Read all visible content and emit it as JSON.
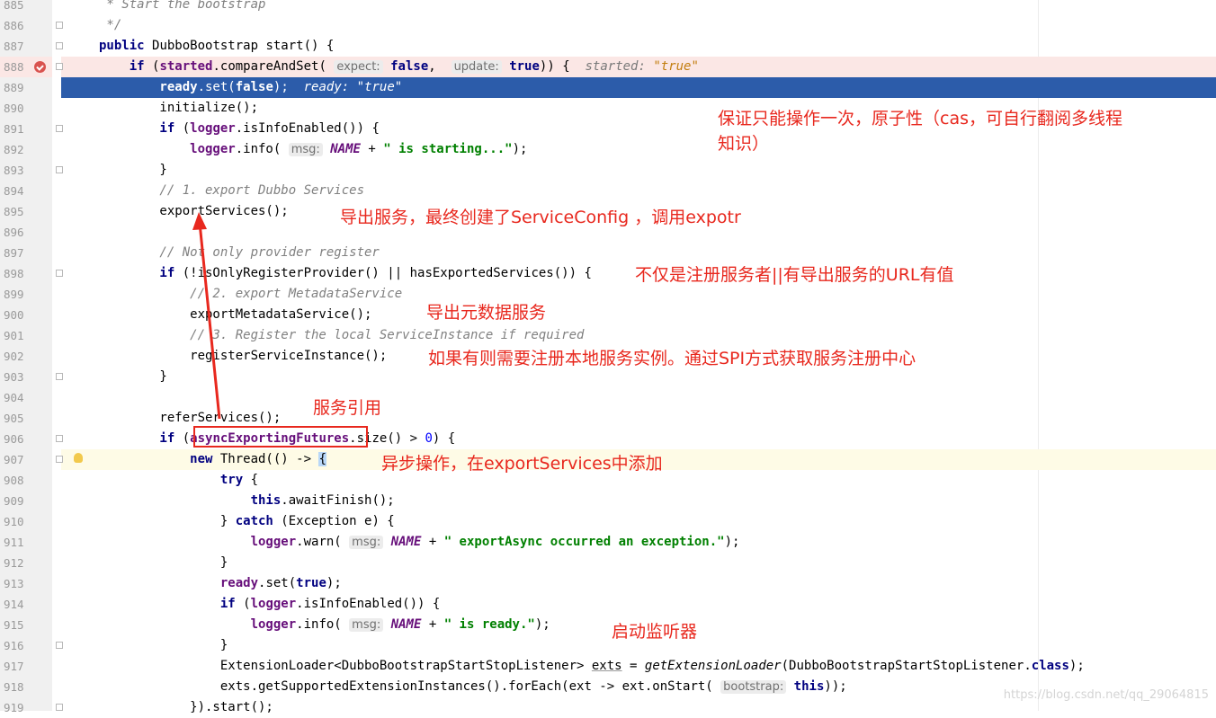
{
  "editor": {
    "lines": [
      {
        "n": "885",
        "parts": [
          {
            "t": " * Start the bootstrap",
            "c": "cmt"
          }
        ]
      },
      {
        "n": "886",
        "parts": [
          {
            "t": " */",
            "c": "cmt"
          }
        ]
      },
      {
        "n": "887",
        "parts": [
          {
            "t": "public ",
            "c": "kw"
          },
          {
            "t": "DubboBootstrap start() {"
          }
        ]
      },
      {
        "n": "888",
        "parts": [
          {
            "t": "    if ",
            "c": "kw"
          },
          {
            "t": "("
          },
          {
            "t": "started",
            "c": "fld"
          },
          {
            "t": ".compareAndSet( "
          },
          {
            "t": "expect:",
            "c": "hint"
          },
          {
            "t": " "
          },
          {
            "t": "false",
            "c": "kw"
          },
          {
            "t": ",  "
          },
          {
            "t": "update:",
            "c": "hint"
          },
          {
            "t": " "
          },
          {
            "t": "true",
            "c": "kw"
          },
          {
            "t": ")) {  "
          },
          {
            "t": "started: ",
            "c": "inl"
          },
          {
            "t": "\"true\"",
            "c": "inls"
          }
        ]
      },
      {
        "n": "889",
        "parts": [
          {
            "t": "        ready",
            "c": "fld"
          },
          {
            "t": ".set("
          },
          {
            "t": "false",
            "c": "kw"
          },
          {
            "t": ");  "
          },
          {
            "t": "ready: ",
            "c": "inl"
          },
          {
            "t": "\"true\"",
            "c": "inls"
          }
        ]
      },
      {
        "n": "890",
        "parts": [
          {
            "t": "        initialize();"
          }
        ]
      },
      {
        "n": "891",
        "parts": [
          {
            "t": "        if ",
            "c": "kw"
          },
          {
            "t": "("
          },
          {
            "t": "logger",
            "c": "fld"
          },
          {
            "t": ".isInfoEnabled()) {"
          }
        ]
      },
      {
        "n": "892",
        "parts": [
          {
            "t": "            logger",
            "c": "fld"
          },
          {
            "t": ".info( "
          },
          {
            "t": "msg:",
            "c": "hint"
          },
          {
            "t": " "
          },
          {
            "t": "NAME",
            "c": "ital"
          },
          {
            "t": " + "
          },
          {
            "t": "\" is starting...\"",
            "c": "str"
          },
          {
            "t": ");"
          }
        ]
      },
      {
        "n": "893",
        "parts": [
          {
            "t": "        }"
          }
        ]
      },
      {
        "n": "894",
        "parts": [
          {
            "t": "        // 1. export Dubbo Services",
            "c": "cmt"
          }
        ]
      },
      {
        "n": "895",
        "parts": [
          {
            "t": "        exportServices();"
          }
        ]
      },
      {
        "n": "896",
        "parts": [
          {
            "t": ""
          }
        ]
      },
      {
        "n": "897",
        "parts": [
          {
            "t": "        // Not only provider register",
            "c": "cmt"
          }
        ]
      },
      {
        "n": "898",
        "parts": [
          {
            "t": "        if ",
            "c": "kw"
          },
          {
            "t": "(!isOnlyRegisterProvider() || hasExportedServices()) {"
          }
        ]
      },
      {
        "n": "899",
        "parts": [
          {
            "t": "            // 2. export MetadataService",
            "c": "cmt"
          }
        ]
      },
      {
        "n": "900",
        "parts": [
          {
            "t": "            exportMetadataService();"
          }
        ]
      },
      {
        "n": "901",
        "parts": [
          {
            "t": "            // 3. Register the local ServiceInstance if required",
            "c": "cmt"
          }
        ]
      },
      {
        "n": "902",
        "parts": [
          {
            "t": "            registerServiceInstance();"
          }
        ]
      },
      {
        "n": "903",
        "parts": [
          {
            "t": "        }"
          }
        ]
      },
      {
        "n": "904",
        "parts": [
          {
            "t": ""
          }
        ]
      },
      {
        "n": "905",
        "parts": [
          {
            "t": "        referServices();"
          }
        ]
      },
      {
        "n": "906",
        "parts": [
          {
            "t": "        if ",
            "c": "kw"
          },
          {
            "t": "("
          },
          {
            "t": "asyncExportingFutures",
            "c": "fld"
          },
          {
            "t": ".size() > "
          },
          {
            "t": "0",
            "c": "num"
          },
          {
            "t": ") {"
          }
        ]
      },
      {
        "n": "907",
        "parts": [
          {
            "t": "            new ",
            "c": "kw"
          },
          {
            "t": "Thread(() -> "
          },
          {
            "t": "{",
            "c": "brk"
          }
        ]
      },
      {
        "n": "908",
        "parts": [
          {
            "t": "                try ",
            "c": "kw"
          },
          {
            "t": "{"
          }
        ]
      },
      {
        "n": "909",
        "parts": [
          {
            "t": "                    this",
            "c": "kw"
          },
          {
            "t": ".awaitFinish();"
          }
        ]
      },
      {
        "n": "910",
        "parts": [
          {
            "t": "                } "
          },
          {
            "t": "catch ",
            "c": "kw"
          },
          {
            "t": "(Exception e) {"
          }
        ]
      },
      {
        "n": "911",
        "parts": [
          {
            "t": "                    logger",
            "c": "fld"
          },
          {
            "t": ".warn( "
          },
          {
            "t": "msg:",
            "c": "hint"
          },
          {
            "t": " "
          },
          {
            "t": "NAME",
            "c": "ital"
          },
          {
            "t": " + "
          },
          {
            "t": "\" exportAsync occurred an exception.\"",
            "c": "str"
          },
          {
            "t": ");"
          }
        ]
      },
      {
        "n": "912",
        "parts": [
          {
            "t": "                }"
          }
        ]
      },
      {
        "n": "913",
        "parts": [
          {
            "t": "                ready",
            "c": "fld"
          },
          {
            "t": ".set("
          },
          {
            "t": "true",
            "c": "kw"
          },
          {
            "t": ");"
          }
        ]
      },
      {
        "n": "914",
        "parts": [
          {
            "t": "                if ",
            "c": "kw"
          },
          {
            "t": "("
          },
          {
            "t": "logger",
            "c": "fld"
          },
          {
            "t": ".isInfoEnabled()) {"
          }
        ]
      },
      {
        "n": "915",
        "parts": [
          {
            "t": "                    logger",
            "c": "fld"
          },
          {
            "t": ".info( "
          },
          {
            "t": "msg:",
            "c": "hint"
          },
          {
            "t": " "
          },
          {
            "t": "NAME",
            "c": "ital"
          },
          {
            "t": " + "
          },
          {
            "t": "\" is ready.\"",
            "c": "str"
          },
          {
            "t": ");"
          }
        ]
      },
      {
        "n": "916",
        "parts": [
          {
            "t": "                }"
          }
        ]
      },
      {
        "n": "917",
        "parts": [
          {
            "t": "                ExtensionLoader<DubboBootstrapStartStopListener> "
          },
          {
            "t": "exts",
            "c": "u"
          },
          {
            "t": " = "
          },
          {
            "t": "getExtensionLoader",
            "c": "it"
          },
          {
            "t": "(DubboBootstrapStartStopListener."
          },
          {
            "t": "class",
            "c": "kw"
          },
          {
            "t": ");"
          }
        ]
      },
      {
        "n": "918",
        "parts": [
          {
            "t": "                exts.getSupportedExtensionInstances().forEach(ext -> ext.onStart( "
          },
          {
            "t": "bootstrap:",
            "c": "hint"
          },
          {
            "t": " "
          },
          {
            "t": "this",
            "c": "kw"
          },
          {
            "t": "));"
          }
        ]
      },
      {
        "n": "919",
        "parts": [
          {
            "t": "            }).start();"
          }
        ]
      }
    ]
  },
  "annotations": {
    "atomic_line1": "保证只能操作一次，原子性（cas，可自行翻阅多线程",
    "atomic_line2": "知识）",
    "export_services": "导出服务，最终创建了ServiceConfig ，调用expotr",
    "not_only_provider": "不仅是注册服务者||有导出服务的URL有值",
    "export_metadata": "导出元数据服务",
    "register_instance": "如果有则需要注册本地服务实例。通过SPI方式获取服务注册中心",
    "refer_services": "服务引用",
    "async_export": "异步操作，在exportServices中添加",
    "start_listener": "启动监听器"
  },
  "watermark": "https://blog.csdn.net/qq_29064815",
  "colors": {
    "annotation_red": "#e8281e",
    "current_line": "#2c5caa",
    "breakpoint_line": "#fbe7e5",
    "keyword": "#000080",
    "field": "#660e7a",
    "string": "#008000",
    "comment": "#808080"
  },
  "icons": [
    "breakpoint-icon",
    "intention-bulb-icon",
    "fold-marker-icon"
  ]
}
